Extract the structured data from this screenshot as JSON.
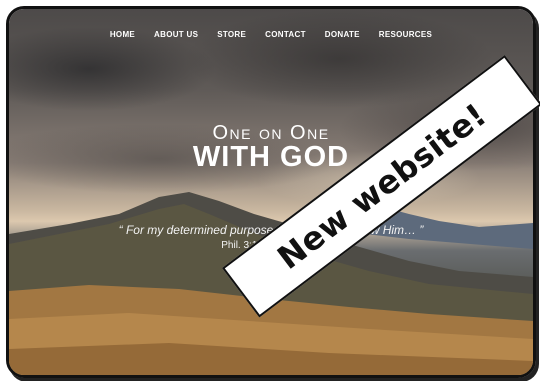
{
  "nav": {
    "items": [
      "HOME",
      "ABOUT US",
      "STORE",
      "CONTACT",
      "DONATE",
      "RESOURCES"
    ]
  },
  "hero": {
    "title_line1": "One on One",
    "title_line2": "WITH GOD",
    "quote": "“ For my determined purpose is that I many know Him… ”",
    "reference": "Phil. 3:10 Amp Classic"
  },
  "banner": {
    "text": "New website!"
  },
  "colors": {
    "frame_border": "#111111",
    "banner_bg": "#ffffff",
    "text": "#ffffff"
  }
}
